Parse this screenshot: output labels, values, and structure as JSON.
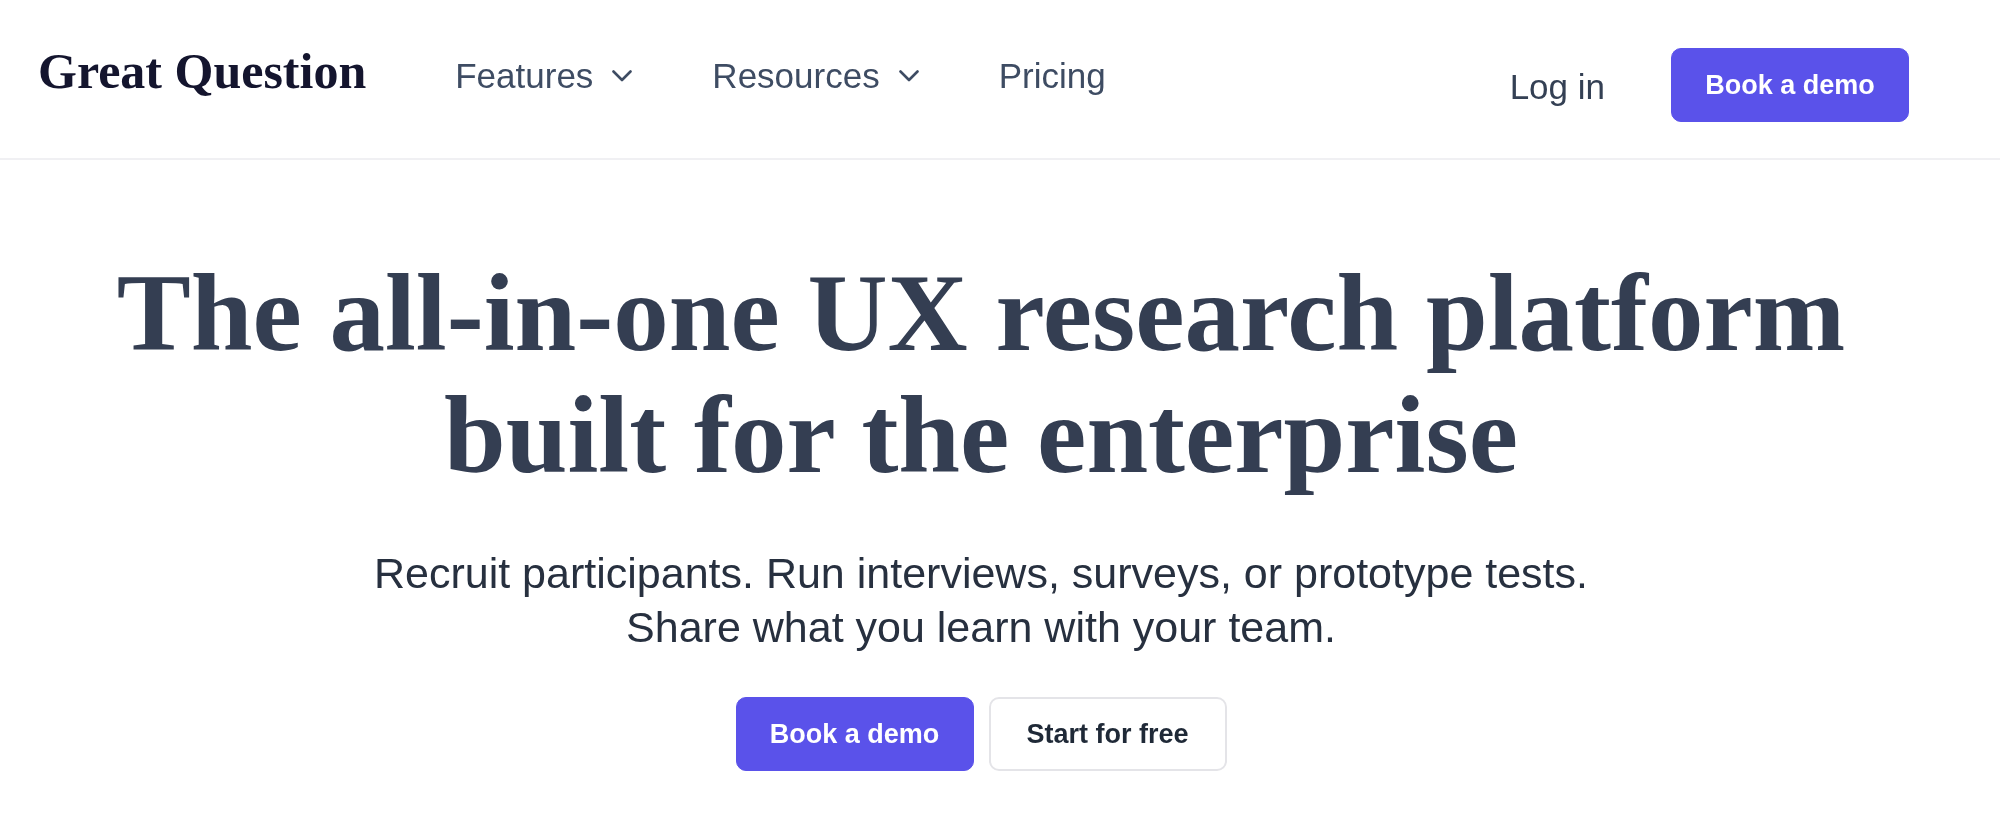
{
  "header": {
    "logo": "Great Question",
    "nav": [
      {
        "label": "Features",
        "kind": "dropdown"
      },
      {
        "label": "Resources",
        "kind": "dropdown"
      },
      {
        "label": "Pricing",
        "kind": "link"
      }
    ],
    "login": "Log in",
    "cta": {
      "label": "Book a demo",
      "kind": "primary"
    }
  },
  "hero": {
    "headline": "The all-in-one UX research platform built for the enterprise",
    "subtitle": "Recruit participants. Run interviews, surveys, or prototype tests. Share what you learn with your team.",
    "buttons": [
      {
        "label": "Book a demo",
        "kind": "primary"
      },
      {
        "label": "Start for free",
        "kind": "secondary"
      }
    ]
  }
}
